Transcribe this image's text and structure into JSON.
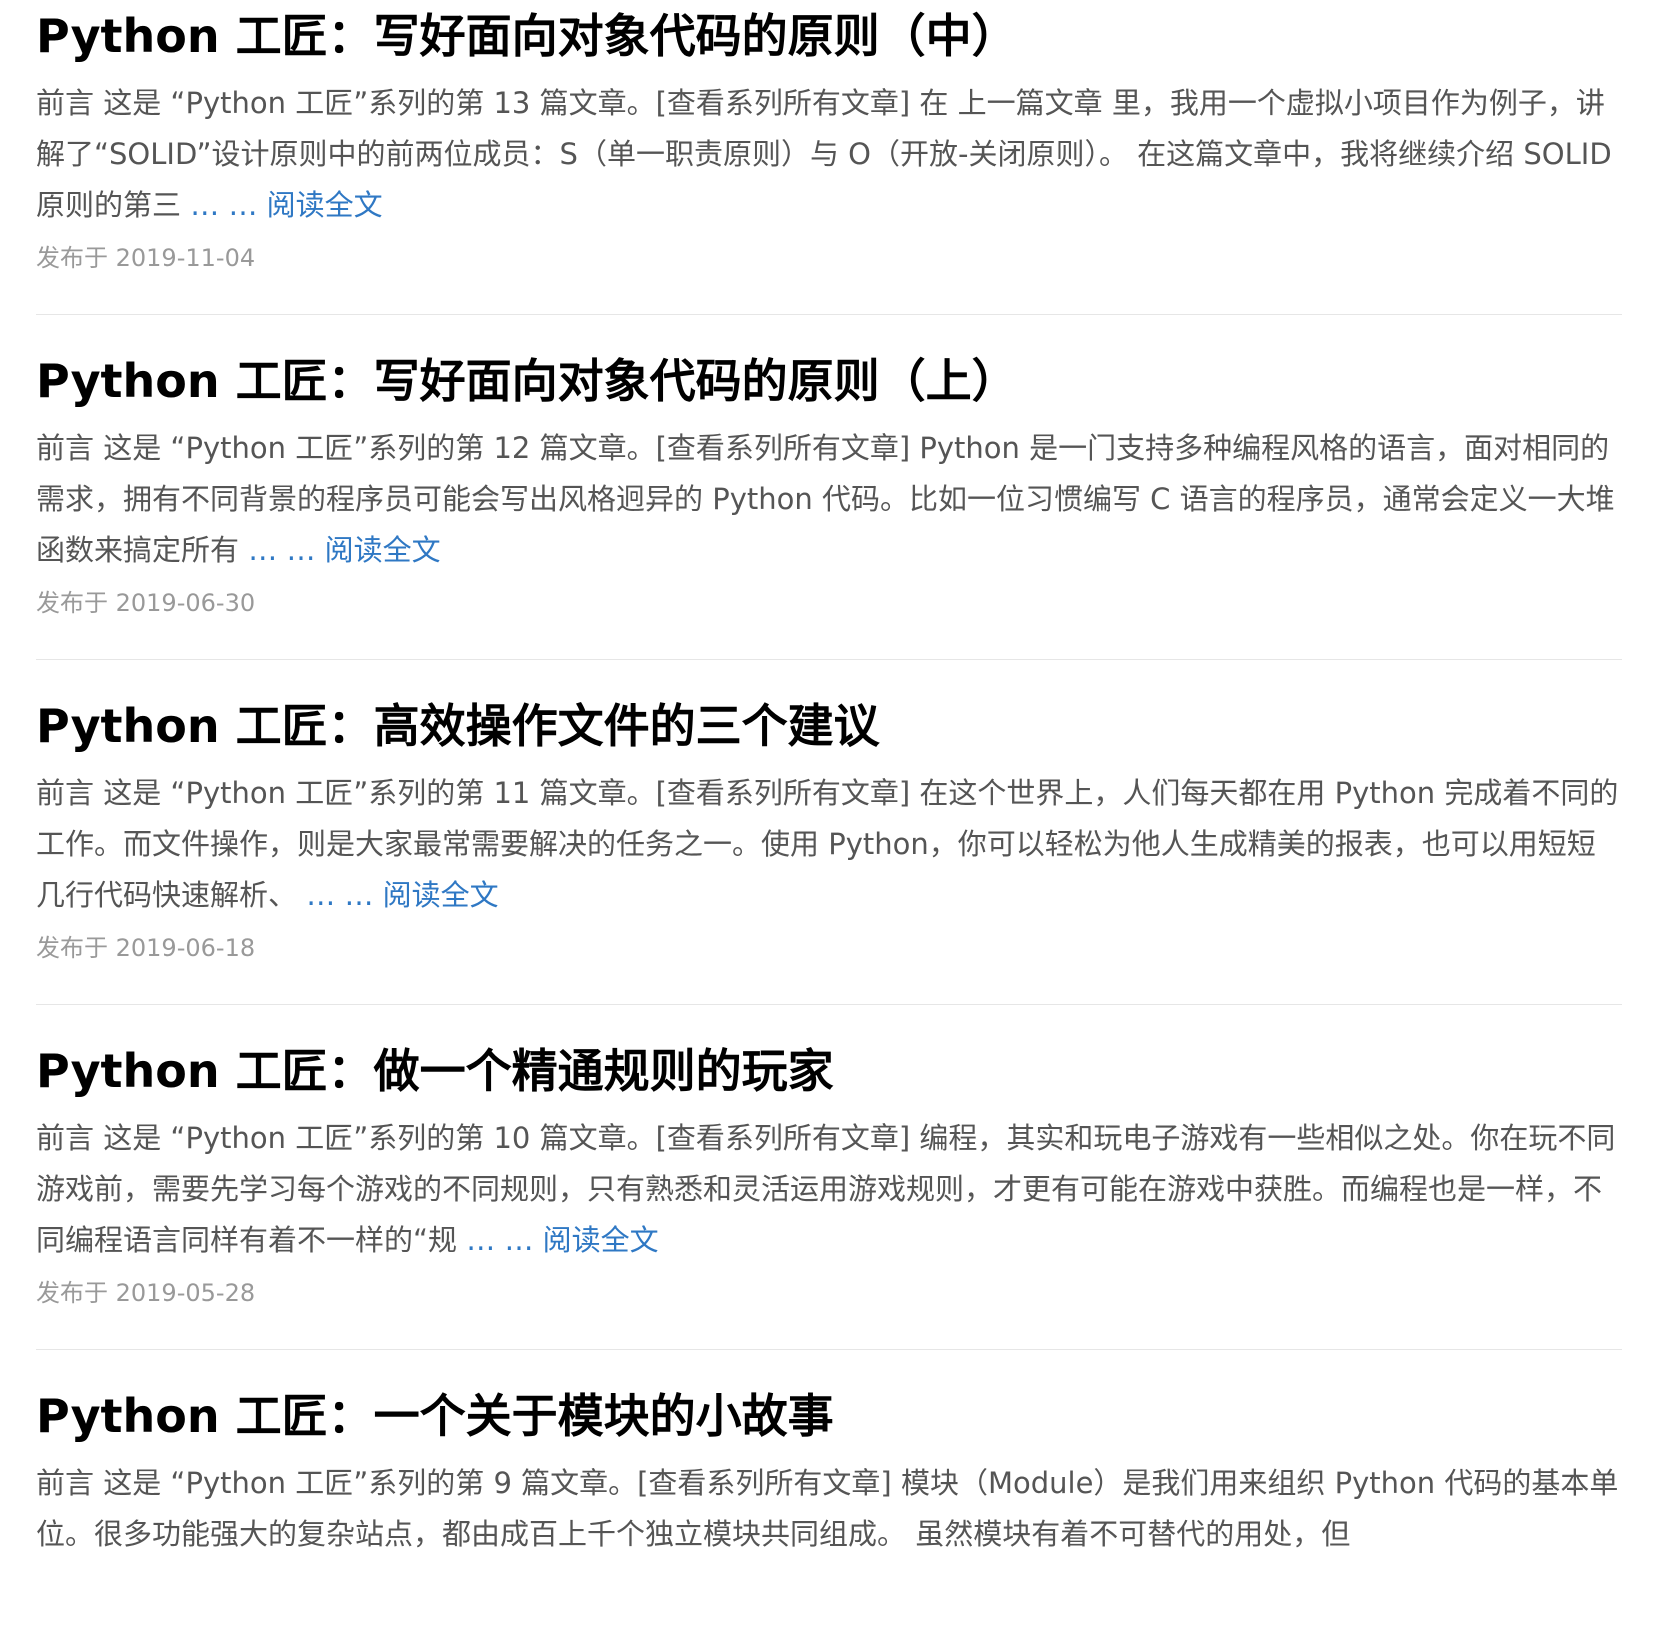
{
  "colors": {
    "title": "#000000",
    "text": "#555555",
    "link": "#2f78c4",
    "date": "#999999",
    "divider": "#e6e6e6"
  },
  "posts": [
    {
      "title": "Python 工匠：写好面向对象代码的原则（中）",
      "excerpt": "前言 这是 “Python 工匠”系列的第 13 篇文章。[查看系列所有文章] 在 上一篇文章 里，我用一个虚拟小项目作为例子，讲解了“SOLID”设计原则中的前两位成员：S（单一职责原则）与 O（开放-关闭原则）。 在这篇文章中，我将继续介绍 SOLID 原则的第三",
      "read_more": "… … 阅读全文",
      "date": "发布于 2019-11-04"
    },
    {
      "title": "Python 工匠：写好面向对象代码的原则（上）",
      "excerpt": "前言 这是 “Python 工匠”系列的第 12 篇文章。[查看系列所有文章] Python 是一门支持多种编程风格的语言，面对相同的需求，拥有不同背景的程序员可能会写出风格迥异的 Python 代码。比如一位习惯编写 C 语言的程序员，通常会定义一大堆函数来搞定所有",
      "read_more": "… … 阅读全文",
      "date": "发布于 2019-06-30"
    },
    {
      "title": "Python 工匠：高效操作文件的三个建议",
      "excerpt": "前言 这是 “Python 工匠”系列的第 11 篇文章。[查看系列所有文章] 在这个世界上，人们每天都在用 Python 完成着不同的工作。而文件操作，则是大家最常需要解决的任务之一。使用 Python，你可以轻松为他人生成精美的报表，也可以用短短几行代码快速解析、",
      "read_more": "… … 阅读全文",
      "date": "发布于 2019-06-18"
    },
    {
      "title": "Python 工匠：做一个精通规则的玩家",
      "excerpt": "前言 这是 “Python 工匠”系列的第 10 篇文章。[查看系列所有文章] 编程，其实和玩电子游戏有一些相似之处。你在玩不同游戏前，需要先学习每个游戏的不同规则，只有熟悉和灵活运用游戏规则，才更有可能在游戏中获胜。而编程也是一样，不同编程语言同样有着不一样的“规",
      "read_more": "… … 阅读全文",
      "date": "发布于 2019-05-28"
    },
    {
      "title": "Python 工匠：一个关于模块的小故事",
      "excerpt": "前言 这是 “Python 工匠”系列的第 9 篇文章。[查看系列所有文章] 模块（Module）是我们用来组织 Python 代码的基本单位。很多功能强大的复杂站点，都由成百上千个独立模块共同组成。 虽然模块有着不可替代的用处，但",
      "read_more": "",
      "date": ""
    }
  ]
}
